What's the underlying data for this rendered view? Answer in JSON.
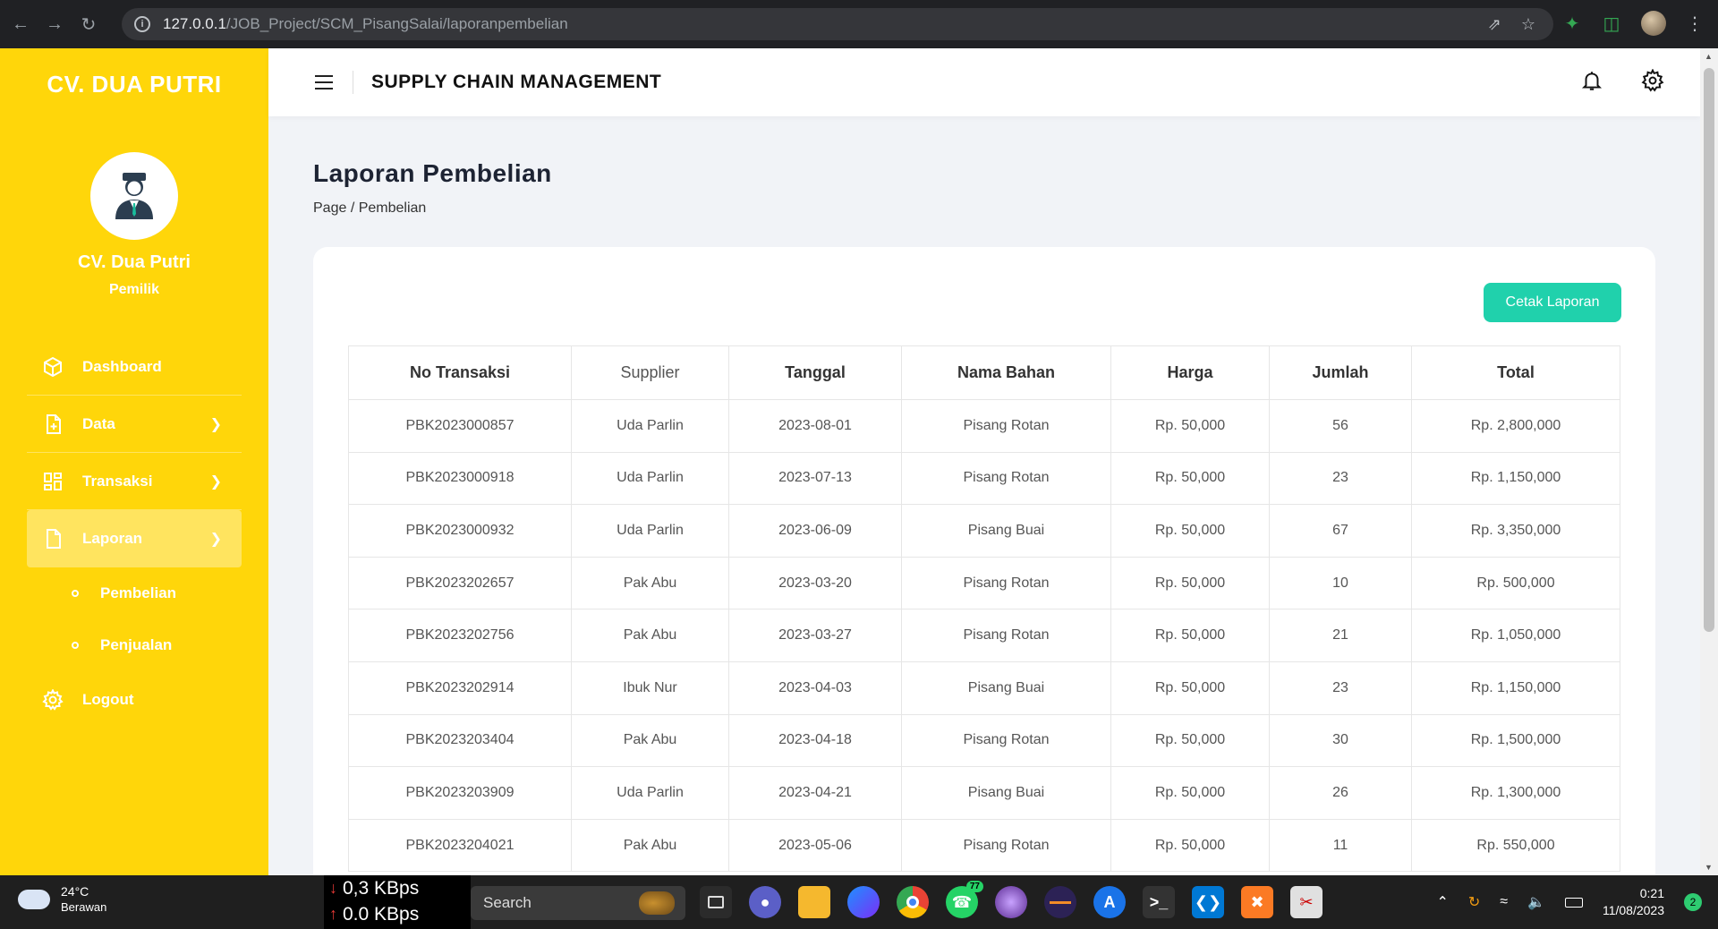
{
  "browser": {
    "url_host": "127.0.0.1",
    "url_path": "/JOB_Project/SCM_PisangSalai/laporanpembelian"
  },
  "sidebar": {
    "brand": "CV. DUA PUTRI",
    "user_name": "CV. Dua Putri",
    "user_role": "Pemilik",
    "items": [
      {
        "label": "Dashboard",
        "icon": "cube-icon"
      },
      {
        "label": "Data",
        "icon": "file-plus-icon"
      },
      {
        "label": "Transaksi",
        "icon": "grid-icon"
      },
      {
        "label": "Laporan",
        "icon": "document-icon"
      },
      {
        "label": "Logout",
        "icon": "gear-icon"
      }
    ],
    "subitems": [
      "Pembelian",
      "Penjualan"
    ]
  },
  "header": {
    "title": "SUPPLY CHAIN MANAGEMENT"
  },
  "page": {
    "title": "Laporan Pembelian",
    "breadcrumb": "Page / Pembelian",
    "print_button": "Cetak Laporan"
  },
  "table": {
    "columns": [
      "No Transaksi",
      "Supplier",
      "Tanggal",
      "Nama Bahan",
      "Harga",
      "Jumlah",
      "Total"
    ],
    "rows": [
      [
        "PBK2023000857",
        "Uda Parlin",
        "2023-08-01",
        "Pisang Rotan",
        "Rp. 50,000",
        "56",
        "Rp. 2,800,000"
      ],
      [
        "PBK2023000918",
        "Uda Parlin",
        "2023-07-13",
        "Pisang Rotan",
        "Rp. 50,000",
        "23",
        "Rp. 1,150,000"
      ],
      [
        "PBK2023000932",
        "Uda Parlin",
        "2023-06-09",
        "Pisang Buai",
        "Rp. 50,000",
        "67",
        "Rp. 3,350,000"
      ],
      [
        "PBK2023202657",
        "Pak Abu",
        "2023-03-20",
        "Pisang Rotan",
        "Rp. 50,000",
        "10",
        "Rp. 500,000"
      ],
      [
        "PBK2023202756",
        "Pak Abu",
        "2023-03-27",
        "Pisang Rotan",
        "Rp. 50,000",
        "21",
        "Rp. 1,050,000"
      ],
      [
        "PBK2023202914",
        "Ibuk Nur",
        "2023-04-03",
        "Pisang Buai",
        "Rp. 50,000",
        "23",
        "Rp. 1,150,000"
      ],
      [
        "PBK2023203404",
        "Pak Abu",
        "2023-04-18",
        "Pisang Rotan",
        "Rp. 50,000",
        "30",
        "Rp. 1,500,000"
      ],
      [
        "PBK2023203909",
        "Uda Parlin",
        "2023-04-21",
        "Pisang Buai",
        "Rp. 50,000",
        "26",
        "Rp. 1,300,000"
      ],
      [
        "PBK2023204021",
        "Pak Abu",
        "2023-05-06",
        "Pisang Rotan",
        "Rp. 50,000",
        "11",
        "Rp. 550,000"
      ]
    ]
  },
  "taskbar": {
    "temperature": "24°C",
    "weather": "Berawan",
    "download_speed": "0,3 KBps",
    "upload_speed": "0.0 KBps",
    "search_label": "Search",
    "whatsapp_badge": "77",
    "time": "0:21",
    "date": "11/08/2023",
    "notification_count": "2"
  },
  "colors": {
    "sidebar": "#ffd60a",
    "accent_button": "#20d1ac",
    "background": "#f1f3f7"
  }
}
